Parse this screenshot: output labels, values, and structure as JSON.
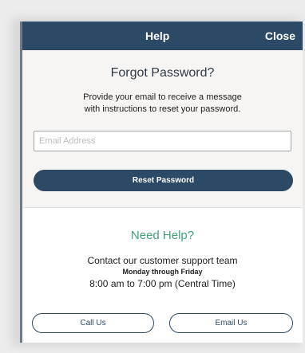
{
  "header": {
    "title": "Help",
    "close_label": "Close"
  },
  "forgot": {
    "title": "Forgot Password?",
    "description_line1": "Provide your email to receive a message",
    "description_line2": "with instructions to reset your password.",
    "email_placeholder": "Email Address",
    "email_value": "",
    "reset_label": "Reset Password"
  },
  "help": {
    "title": "Need Help?",
    "contact_text": "Contact our customer support team",
    "hours_days": "Monday through Friday",
    "hours_time": "8:00 am to 7:00 pm (Central Time)",
    "call_label": "Call Us",
    "email_label": "Email Us"
  },
  "colors": {
    "header_bg": "#2c4a66",
    "accent_green": "#3fa27a",
    "section_bg": "#f6f5f4"
  }
}
